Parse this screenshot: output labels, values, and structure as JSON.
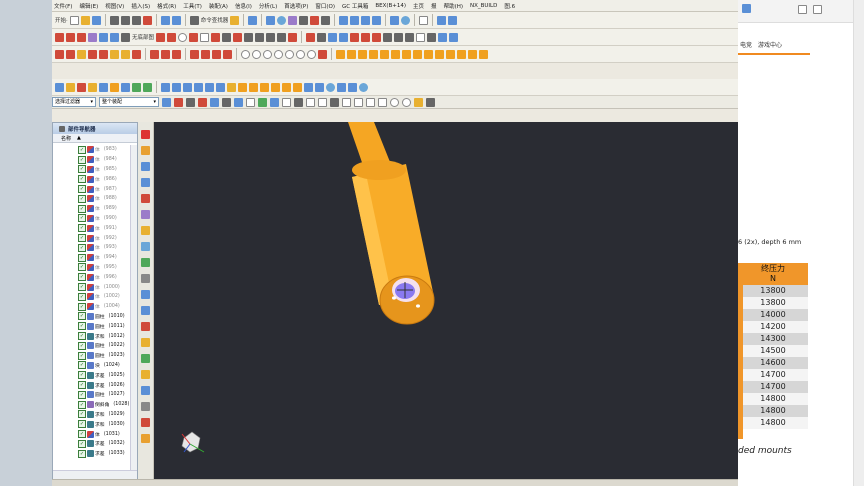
{
  "menubar": {
    "items": [
      "文件(F)",
      "编辑(E)",
      "视图(V)",
      "插入(S)",
      "格式(R)",
      "工具(T)",
      "装配(A)",
      "信息(I)",
      "分析(L)",
      "首选项(P)",
      "窗口(O)",
      "GC 工具箱",
      "BEX(B+14)",
      "主页",
      "报",
      "帮助(H)",
      "NX_BUILD",
      "图.6"
    ]
  },
  "toolbar1": {
    "start_label": "开始·",
    "command_finder": "命令查找器"
  },
  "toolbar2": {
    "label": "无底部图"
  },
  "selection": {
    "filter": "选择过滤器",
    "scope": "整个装配"
  },
  "navigator": {
    "title": "部件导航器",
    "col_name": "名称",
    "rows": [
      {
        "name": "体",
        "id": "(983)",
        "type": "body",
        "suppressed": true
      },
      {
        "name": "体",
        "id": "(984)",
        "type": "body",
        "suppressed": true
      },
      {
        "name": "体",
        "id": "(985)",
        "type": "body",
        "suppressed": true
      },
      {
        "name": "体",
        "id": "(986)",
        "type": "body",
        "suppressed": true
      },
      {
        "name": "体",
        "id": "(987)",
        "type": "body",
        "suppressed": true
      },
      {
        "name": "体",
        "id": "(988)",
        "type": "body",
        "suppressed": true
      },
      {
        "name": "体",
        "id": "(989)",
        "type": "body",
        "suppressed": true
      },
      {
        "name": "体",
        "id": "(990)",
        "type": "body",
        "suppressed": true
      },
      {
        "name": "体",
        "id": "(991)",
        "type": "body",
        "suppressed": true
      },
      {
        "name": "体",
        "id": "(992)",
        "type": "body",
        "suppressed": true
      },
      {
        "name": "体",
        "id": "(993)",
        "type": "body",
        "suppressed": true
      },
      {
        "name": "体",
        "id": "(994)",
        "type": "body",
        "suppressed": true
      },
      {
        "name": "体",
        "id": "(995)",
        "type": "body",
        "suppressed": true
      },
      {
        "name": "体",
        "id": "(996)",
        "type": "body",
        "suppressed": true
      },
      {
        "name": "体",
        "id": "(1000)",
        "type": "body",
        "suppressed": true
      },
      {
        "name": "体",
        "id": "(1002)",
        "type": "body",
        "suppressed": true
      },
      {
        "name": "体",
        "id": "(1004)",
        "type": "body",
        "suppressed": true
      },
      {
        "name": "圆柱",
        "id": "(1010)",
        "type": "cyl",
        "suppressed": false
      },
      {
        "name": "圆柱",
        "id": "(1011)",
        "type": "cyl",
        "suppressed": false
      },
      {
        "name": "求和",
        "id": "(1012)",
        "type": "sub",
        "suppressed": false
      },
      {
        "name": "圆柱",
        "id": "(1022)",
        "type": "cyl",
        "suppressed": false
      },
      {
        "name": "圆柱",
        "id": "(1023)",
        "type": "cyl",
        "suppressed": false
      },
      {
        "name": "块",
        "id": "(1024)",
        "type": "cyl",
        "suppressed": false
      },
      {
        "name": "求差",
        "id": "(1025)",
        "type": "sub",
        "suppressed": false
      },
      {
        "name": "求差",
        "id": "(1026)",
        "type": "sub",
        "suppressed": false
      },
      {
        "name": "圆柱",
        "id": "(1027)",
        "type": "cyl",
        "suppressed": false
      },
      {
        "name": "倒斜角",
        "id": "(1028)",
        "type": "chamf",
        "suppressed": false
      },
      {
        "name": "求和",
        "id": "(1029)",
        "type": "sub",
        "suppressed": false
      },
      {
        "name": "求和",
        "id": "(1030)",
        "type": "sub",
        "suppressed": false
      },
      {
        "name": "体",
        "id": "(1031)",
        "type": "body",
        "suppressed": false
      },
      {
        "name": "求差",
        "id": "(1032)",
        "type": "sub",
        "suppressed": false
      },
      {
        "name": "求差",
        "id": "(1033)",
        "type": "sub",
        "suppressed": false
      }
    ]
  },
  "right_window": {
    "tabs": [
      "电竞",
      "游戏中心"
    ],
    "caption": "6 (2x), depth 6 mm",
    "table_head": "终压力",
    "table_unit": "N",
    "table_values": [
      "13800",
      "13800",
      "14000",
      "14200",
      "14300",
      "14500",
      "14600",
      "14700",
      "14700",
      "14800",
      "14800",
      "14800"
    ],
    "footer": "ded mounts"
  },
  "colors": {
    "viewport_bg": "#2a2c33",
    "part_orange": "#f5a623",
    "accent_orange": "#f0962a"
  }
}
